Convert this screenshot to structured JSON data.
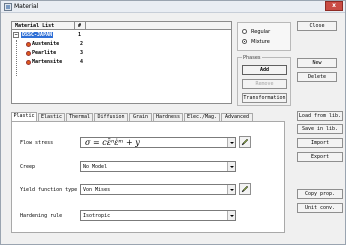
{
  "window": {
    "title": "Material",
    "close_glyph": "x"
  },
  "material_list": {
    "header_name": "Material List",
    "header_num": "#",
    "items": [
      {
        "label": "DSSC-JAPAN",
        "num": "1"
      },
      {
        "label": "Austenite",
        "num": "2"
      },
      {
        "label": "Pearlite",
        "num": "3"
      },
      {
        "label": "Martensite",
        "num": "4"
      }
    ]
  },
  "mode": {
    "options": [
      {
        "label": "Regular",
        "selected": false
      },
      {
        "label": "Mixture",
        "selected": true
      }
    ]
  },
  "phases": {
    "title": "Phases",
    "add": "Add",
    "remove": "Remove",
    "transformation": "Transformation"
  },
  "side_buttons": {
    "close": "Close",
    "new": "New",
    "delete": "Delete",
    "load_from_lib": "Load from lib.",
    "save_in_lib": "Save in lib.",
    "import": "Import",
    "export": "Export",
    "copy_prop": "Copy prop.",
    "unit_conv": "Unit conv."
  },
  "tabs": [
    {
      "label": "Plastic",
      "active": true
    },
    {
      "label": "Elastic",
      "active": false
    },
    {
      "label": "Thermal",
      "active": false
    },
    {
      "label": "Diffusion",
      "active": false
    },
    {
      "label": "Grain",
      "active": false
    },
    {
      "label": "Hardness",
      "active": false
    },
    {
      "label": "Elec./Mag.",
      "active": false
    },
    {
      "label": "Advanced",
      "active": false
    }
  ],
  "properties": {
    "flow_stress": {
      "label": "Flow stress",
      "value": "σ = cε̄ⁿε̇ᵐ + y"
    },
    "creep": {
      "label": "Creep",
      "value": "No Model"
    },
    "yield_function": {
      "label": "Yield function type",
      "value": "Von Mises"
    },
    "hardening": {
      "label": "Hardening rule",
      "value": "Isotropic"
    }
  },
  "colors": {
    "selection": "#2f6fd6",
    "tree_icon": "#e05a1a",
    "close": "#c94c44"
  }
}
